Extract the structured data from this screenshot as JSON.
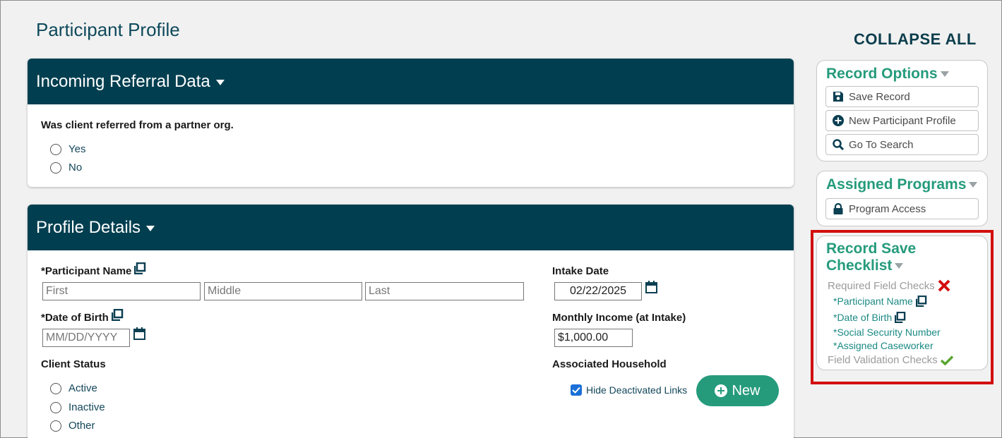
{
  "page": {
    "title": "Participant Profile",
    "collapse_all": "COLLAPSE ALL"
  },
  "referral": {
    "header": "Incoming Referral Data",
    "question": "Was client referred from a partner org.",
    "options": [
      "Yes",
      "No"
    ]
  },
  "profile": {
    "header": "Profile Details",
    "participant_name_label": "*Participant Name",
    "first_placeholder": "First",
    "middle_placeholder": "Middle",
    "last_placeholder": "Last",
    "dob_label": "*Date of Birth",
    "dob_placeholder": "MM/DD/YYYY",
    "client_status_label": "Client Status",
    "status_options": [
      "Active",
      "Inactive",
      "Other"
    ],
    "intake_date_label": "Intake Date",
    "intake_date_value": "02/22/2025",
    "monthly_income_label": "Monthly Income (at Intake)",
    "monthly_income_value": "$1,000.00",
    "household_label": "Associated Household",
    "hide_deactivated_label": "Hide Deactivated Links",
    "new_button": "New"
  },
  "record_options": {
    "title": "Record Options",
    "buttons": [
      "Save Record",
      "New Participant Profile",
      "Go To Search"
    ]
  },
  "assigned_programs": {
    "title": "Assigned Programs",
    "buttons": [
      "Program Access"
    ]
  },
  "checklist": {
    "title_line1": "Record Save",
    "title_line2": "Checklist",
    "required_label": "Required Field Checks",
    "required_items": [
      "*Participant Name",
      "*Date of Birth",
      "*Social Security Number",
      "*Assigned Caseworker"
    ],
    "validation_label": "Field Validation Checks"
  },
  "colors": {
    "header_bg": "#013f50",
    "accent_green": "#259b7c",
    "link_teal": "#1b8a84",
    "error_red": "#d20f0f",
    "success_green": "#5aa532"
  }
}
